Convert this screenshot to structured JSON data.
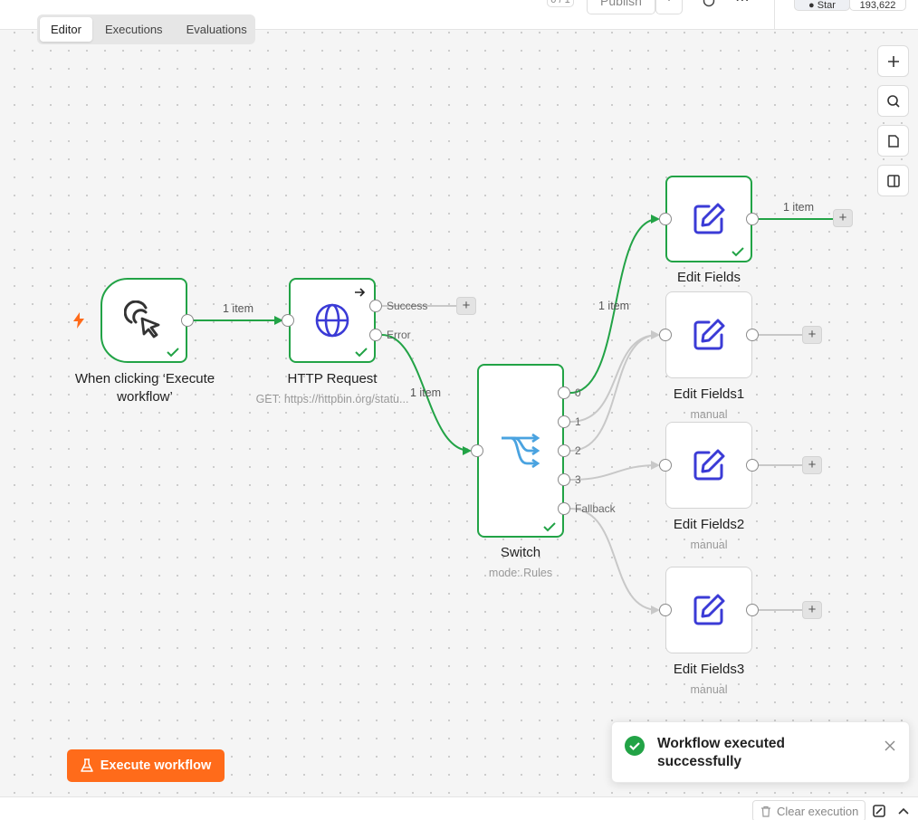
{
  "header": {
    "counter": "0 / 1",
    "publish_label": "Publish",
    "star_label": "Star",
    "star_count": "193,622"
  },
  "tabs": [
    {
      "label": "Editor",
      "active": true
    },
    {
      "label": "Executions",
      "active": false
    },
    {
      "label": "Evaluations",
      "active": false
    }
  ],
  "side_toolbar": {
    "zoom_in": "plus-icon",
    "search": "search-icon",
    "sticky": "note-icon",
    "panel": "panel-icon"
  },
  "nodes": {
    "trigger": {
      "title_line1": "When clicking ‘Execute",
      "title_line2": "workflow’"
    },
    "http": {
      "title": "HTTP Request",
      "subtitle": "GET: https://httpbin.org/statu...",
      "port_success": "Success",
      "port_error": "Error"
    },
    "switch": {
      "title": "Switch",
      "subtitle": "mode: Rules",
      "ports": [
        "0",
        "1",
        "2",
        "3",
        "Fallback"
      ]
    },
    "edit": {
      "title": "Edit Fields"
    },
    "edit1": {
      "title": "Edit Fields1",
      "subtitle": "manual"
    },
    "edit2": {
      "title": "Edit Fields2",
      "subtitle": "manual"
    },
    "edit3": {
      "title": "Edit Fields3",
      "subtitle": "manual"
    }
  },
  "edge_labels": {
    "trigger_http": "1 item",
    "http_switch": "1 item",
    "switch_edit": "1 item",
    "edit_out": "1 item"
  },
  "execute_button": {
    "label": "Execute workflow"
  },
  "toast": {
    "line1": "Workflow executed",
    "line2": "successfully"
  },
  "bottom": {
    "clear_label": "Clear execution"
  },
  "colors": {
    "success": "#22a346",
    "accent": "#ff6b1a",
    "node_icon": "#3b3bd6",
    "switch_icon": "#4aa3e0"
  }
}
